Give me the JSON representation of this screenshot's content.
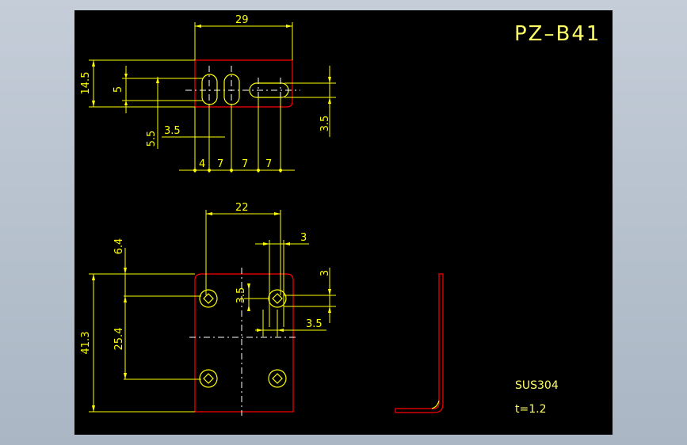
{
  "drawing": {
    "title": "PZ–B41",
    "material": "SUS304",
    "thickness": "t=1.2"
  },
  "top_view": {
    "dim_width": "29",
    "dim_height": "14.5",
    "dim_slot": "5",
    "dim_5_5": "5.5",
    "dim_3_5_h": "3.5",
    "dim_3_5_v": "3.5",
    "dim_a": "4",
    "dim_b": "7",
    "dim_c": "7",
    "dim_d": "7"
  },
  "front_view": {
    "dim_width": "22",
    "dim_3_top": "3",
    "dim_6_4": "6.4",
    "dim_3_right": "3",
    "dim_3_5_inner": "3.5",
    "dim_3_5_right": "3.5",
    "dim_25_4": "25.4",
    "dim_41_3": "41.3"
  },
  "colors": {
    "background": "#000000",
    "dimension": "#ffff00",
    "outline": "#ff0000",
    "centerline": "#ffffff",
    "title": "#ffff66"
  }
}
